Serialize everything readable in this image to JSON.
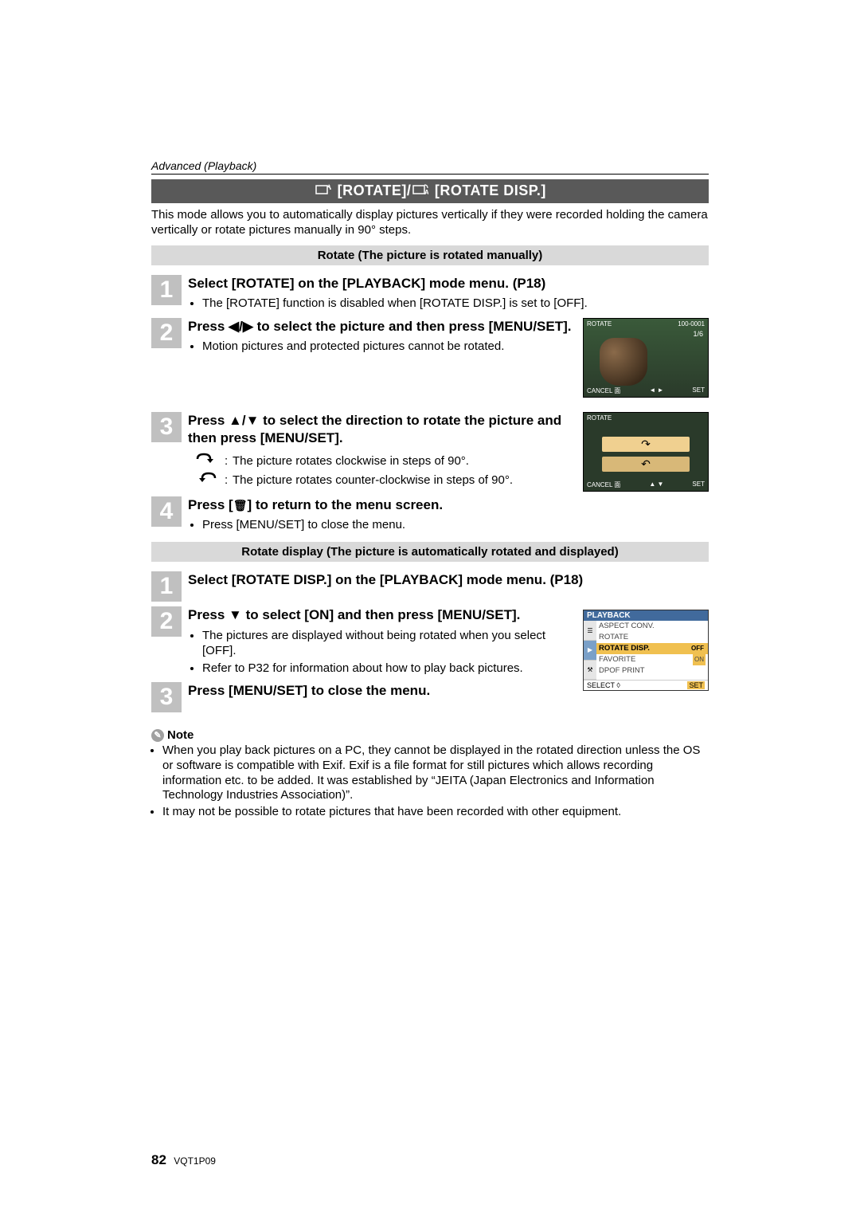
{
  "header": {
    "section": "Advanced (Playback)"
  },
  "title": {
    "p1": " [ROTATE]/",
    "p2": " [ROTATE DISP.]"
  },
  "intro": "This mode allows you to automatically display pictures vertically if they were recorded holding the camera vertically or rotate pictures manually in 90° steps.",
  "sub1": "Rotate (The picture is rotated manually)",
  "s1": {
    "n": "1",
    "title": "Select [ROTATE] on the [PLAYBACK] mode menu. (P18)",
    "bul": "The [ROTATE] function is disabled when [ROTATE DISP.] is set to [OFF]."
  },
  "s2": {
    "n": "2",
    "title_a": "Press ",
    "title_b": " to select the picture and then press [MENU/SET].",
    "bul": "Motion pictures and protected pictures cannot be rotated."
  },
  "s3": {
    "n": "3",
    "title_a": "Press ",
    "title_b": " to select the direction to rotate the picture and then press [MENU/SET].",
    "row1": "The picture rotates clockwise in steps of 90°.",
    "row2": "The picture rotates counter-clockwise in steps of 90°."
  },
  "s4": {
    "n": "4",
    "title_a": "Press [",
    "title_b": "] to return to the menu screen.",
    "bul": "Press [MENU/SET] to close the menu."
  },
  "sub2": "Rotate display (The picture is automatically rotated and displayed)",
  "d1": {
    "n": "1",
    "title": "Select [ROTATE DISP.] on the [PLAYBACK] mode menu. (P18)"
  },
  "d2": {
    "n": "2",
    "title_a": "Press ",
    "title_b": " to select [ON] and then press [MENU/SET].",
    "bul1": "The pictures are displayed without being rotated when you select [OFF].",
    "bul2": "Refer to P32 for information about how to play back pictures."
  },
  "d3": {
    "n": "3",
    "title": "Press [MENU/SET] to close the menu."
  },
  "shot1": {
    "mode": "ROTATE",
    "file": "100-0001",
    "count": "1/6",
    "cancel": "CANCEL",
    "select_sym": "◄ ►",
    "set": "SET"
  },
  "shot2": {
    "mode": "ROTATE",
    "cancel": "CANCEL",
    "select_sym": "▲ ▼",
    "set": "SET"
  },
  "menushot": {
    "title": "PLAYBACK",
    "items": [
      {
        "label": "ASPECT CONV.",
        "val": ""
      },
      {
        "label": "ROTATE",
        "val": ""
      },
      {
        "label": "ROTATE DISP.",
        "val": "OFF",
        "sel": true
      },
      {
        "label": "FAVORITE",
        "val": "ON"
      },
      {
        "label": "DPOF PRINT",
        "val": ""
      }
    ],
    "select": "SELECT",
    "set": "SET"
  },
  "note": {
    "label": "Note",
    "b1": "When you play back pictures on a PC, they cannot be displayed in the rotated direction unless the OS or software is compatible with Exif. Exif is a file format for still pictures which allows recording information etc. to be added. It was established by “JEITA (Japan Electronics and Information Technology Industries Association)”.",
    "b2": "It may not be possible to rotate pictures that have been recorded with other equipment."
  },
  "footer": {
    "page": "82",
    "code": "VQT1P09"
  }
}
